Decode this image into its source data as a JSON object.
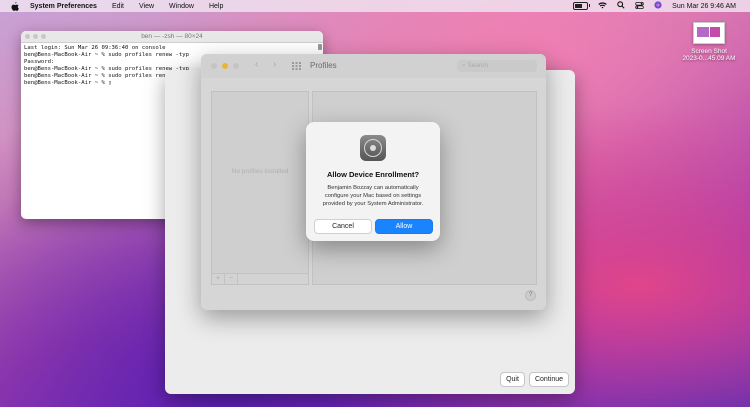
{
  "menubar": {
    "app_name": "System Preferences",
    "menus": [
      "Edit",
      "View",
      "Window",
      "Help"
    ],
    "clock": "Sun Mar 26  9:46 AM"
  },
  "desktop": {
    "screenshot_label_line1": "Screen Shot",
    "screenshot_label_line2": "2023-0...45.09 AM"
  },
  "terminal": {
    "title": "ben — -zsh — 80×24",
    "lines": [
      "Last login: Sun Mar 26 09:36:40 on console",
      "ben@Bens-MacBook-Air ~ % sudo profiles renew -typ",
      "Password:",
      "ben@Bens-MacBook-Air ~ % sudo profiles renew -typ",
      "ben@Bens-MacBook-Air ~ % sudo profiles renew -typ",
      "ben@Bens-MacBook-Air ~ % ▯"
    ]
  },
  "enroll_window": {
    "quit_label": "Quit",
    "continue_label": "Continue"
  },
  "profiles_window": {
    "title": "Profiles",
    "search_placeholder": "Search",
    "empty_text": "No profiles installed",
    "add_label": "+",
    "remove_label": "−",
    "help_label": "?"
  },
  "alert": {
    "title": "Allow Device Enrollment?",
    "message": "Benjamin Bozzay can automatically configure your Mac based on settings provided by your System Administrator.",
    "cancel_label": "Cancel",
    "allow_label": "Allow",
    "accent": "#1a84ff"
  }
}
